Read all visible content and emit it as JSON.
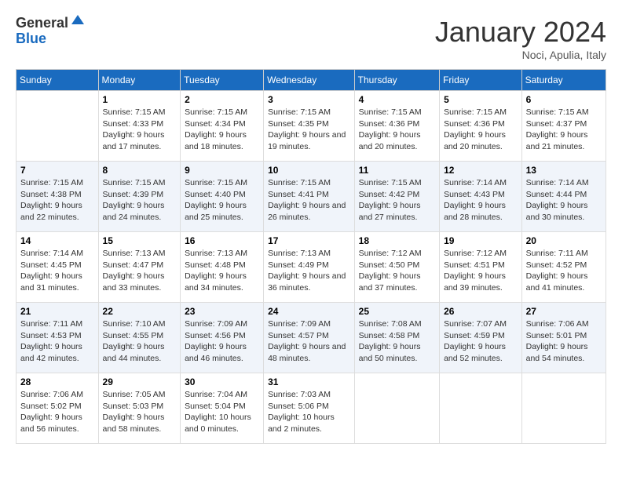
{
  "logo": {
    "general": "General",
    "blue": "Blue"
  },
  "header": {
    "month": "January 2024",
    "location": "Noci, Apulia, Italy"
  },
  "days_of_week": [
    "Sunday",
    "Monday",
    "Tuesday",
    "Wednesday",
    "Thursday",
    "Friday",
    "Saturday"
  ],
  "weeks": [
    [
      {
        "day": "",
        "sunrise": "",
        "sunset": "",
        "daylight": ""
      },
      {
        "day": "1",
        "sunrise": "Sunrise: 7:15 AM",
        "sunset": "Sunset: 4:33 PM",
        "daylight": "Daylight: 9 hours and 17 minutes."
      },
      {
        "day": "2",
        "sunrise": "Sunrise: 7:15 AM",
        "sunset": "Sunset: 4:34 PM",
        "daylight": "Daylight: 9 hours and 18 minutes."
      },
      {
        "day": "3",
        "sunrise": "Sunrise: 7:15 AM",
        "sunset": "Sunset: 4:35 PM",
        "daylight": "Daylight: 9 hours and 19 minutes."
      },
      {
        "day": "4",
        "sunrise": "Sunrise: 7:15 AM",
        "sunset": "Sunset: 4:36 PM",
        "daylight": "Daylight: 9 hours and 20 minutes."
      },
      {
        "day": "5",
        "sunrise": "Sunrise: 7:15 AM",
        "sunset": "Sunset: 4:36 PM",
        "daylight": "Daylight: 9 hours and 20 minutes."
      },
      {
        "day": "6",
        "sunrise": "Sunrise: 7:15 AM",
        "sunset": "Sunset: 4:37 PM",
        "daylight": "Daylight: 9 hours and 21 minutes."
      }
    ],
    [
      {
        "day": "7",
        "sunrise": "Sunrise: 7:15 AM",
        "sunset": "Sunset: 4:38 PM",
        "daylight": "Daylight: 9 hours and 22 minutes."
      },
      {
        "day": "8",
        "sunrise": "Sunrise: 7:15 AM",
        "sunset": "Sunset: 4:39 PM",
        "daylight": "Daylight: 9 hours and 24 minutes."
      },
      {
        "day": "9",
        "sunrise": "Sunrise: 7:15 AM",
        "sunset": "Sunset: 4:40 PM",
        "daylight": "Daylight: 9 hours and 25 minutes."
      },
      {
        "day": "10",
        "sunrise": "Sunrise: 7:15 AM",
        "sunset": "Sunset: 4:41 PM",
        "daylight": "Daylight: 9 hours and 26 minutes."
      },
      {
        "day": "11",
        "sunrise": "Sunrise: 7:15 AM",
        "sunset": "Sunset: 4:42 PM",
        "daylight": "Daylight: 9 hours and 27 minutes."
      },
      {
        "day": "12",
        "sunrise": "Sunrise: 7:14 AM",
        "sunset": "Sunset: 4:43 PM",
        "daylight": "Daylight: 9 hours and 28 minutes."
      },
      {
        "day": "13",
        "sunrise": "Sunrise: 7:14 AM",
        "sunset": "Sunset: 4:44 PM",
        "daylight": "Daylight: 9 hours and 30 minutes."
      }
    ],
    [
      {
        "day": "14",
        "sunrise": "Sunrise: 7:14 AM",
        "sunset": "Sunset: 4:45 PM",
        "daylight": "Daylight: 9 hours and 31 minutes."
      },
      {
        "day": "15",
        "sunrise": "Sunrise: 7:13 AM",
        "sunset": "Sunset: 4:47 PM",
        "daylight": "Daylight: 9 hours and 33 minutes."
      },
      {
        "day": "16",
        "sunrise": "Sunrise: 7:13 AM",
        "sunset": "Sunset: 4:48 PM",
        "daylight": "Daylight: 9 hours and 34 minutes."
      },
      {
        "day": "17",
        "sunrise": "Sunrise: 7:13 AM",
        "sunset": "Sunset: 4:49 PM",
        "daylight": "Daylight: 9 hours and 36 minutes."
      },
      {
        "day": "18",
        "sunrise": "Sunrise: 7:12 AM",
        "sunset": "Sunset: 4:50 PM",
        "daylight": "Daylight: 9 hours and 37 minutes."
      },
      {
        "day": "19",
        "sunrise": "Sunrise: 7:12 AM",
        "sunset": "Sunset: 4:51 PM",
        "daylight": "Daylight: 9 hours and 39 minutes."
      },
      {
        "day": "20",
        "sunrise": "Sunrise: 7:11 AM",
        "sunset": "Sunset: 4:52 PM",
        "daylight": "Daylight: 9 hours and 41 minutes."
      }
    ],
    [
      {
        "day": "21",
        "sunrise": "Sunrise: 7:11 AM",
        "sunset": "Sunset: 4:53 PM",
        "daylight": "Daylight: 9 hours and 42 minutes."
      },
      {
        "day": "22",
        "sunrise": "Sunrise: 7:10 AM",
        "sunset": "Sunset: 4:55 PM",
        "daylight": "Daylight: 9 hours and 44 minutes."
      },
      {
        "day": "23",
        "sunrise": "Sunrise: 7:09 AM",
        "sunset": "Sunset: 4:56 PM",
        "daylight": "Daylight: 9 hours and 46 minutes."
      },
      {
        "day": "24",
        "sunrise": "Sunrise: 7:09 AM",
        "sunset": "Sunset: 4:57 PM",
        "daylight": "Daylight: 9 hours and 48 minutes."
      },
      {
        "day": "25",
        "sunrise": "Sunrise: 7:08 AM",
        "sunset": "Sunset: 4:58 PM",
        "daylight": "Daylight: 9 hours and 50 minutes."
      },
      {
        "day": "26",
        "sunrise": "Sunrise: 7:07 AM",
        "sunset": "Sunset: 4:59 PM",
        "daylight": "Daylight: 9 hours and 52 minutes."
      },
      {
        "day": "27",
        "sunrise": "Sunrise: 7:06 AM",
        "sunset": "Sunset: 5:01 PM",
        "daylight": "Daylight: 9 hours and 54 minutes."
      }
    ],
    [
      {
        "day": "28",
        "sunrise": "Sunrise: 7:06 AM",
        "sunset": "Sunset: 5:02 PM",
        "daylight": "Daylight: 9 hours and 56 minutes."
      },
      {
        "day": "29",
        "sunrise": "Sunrise: 7:05 AM",
        "sunset": "Sunset: 5:03 PM",
        "daylight": "Daylight: 9 hours and 58 minutes."
      },
      {
        "day": "30",
        "sunrise": "Sunrise: 7:04 AM",
        "sunset": "Sunset: 5:04 PM",
        "daylight": "Daylight: 10 hours and 0 minutes."
      },
      {
        "day": "31",
        "sunrise": "Sunrise: 7:03 AM",
        "sunset": "Sunset: 5:06 PM",
        "daylight": "Daylight: 10 hours and 2 minutes."
      },
      {
        "day": "",
        "sunrise": "",
        "sunset": "",
        "daylight": ""
      },
      {
        "day": "",
        "sunrise": "",
        "sunset": "",
        "daylight": ""
      },
      {
        "day": "",
        "sunrise": "",
        "sunset": "",
        "daylight": ""
      }
    ]
  ]
}
